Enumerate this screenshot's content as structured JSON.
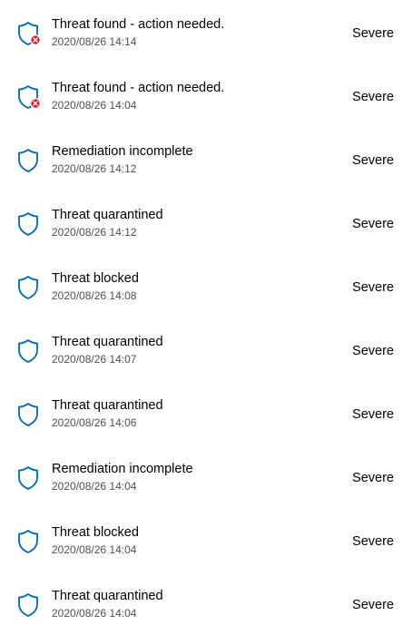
{
  "accent_color": "#0067c0",
  "badge_color": "#e81123",
  "icon": "shield-icon",
  "items": [
    {
      "title": "Threat found - action needed.",
      "timestamp": "2020/08/26 14:14",
      "severity": "Severe",
      "badge": "error-badge-icon"
    },
    {
      "title": "Threat found - action needed.",
      "timestamp": "2020/08/26 14:04",
      "severity": "Severe",
      "badge": "error-badge-icon"
    },
    {
      "title": "Remediation incomplete",
      "timestamp": "2020/08/26 14:12",
      "severity": "Severe",
      "badge": ""
    },
    {
      "title": "Threat quarantined",
      "timestamp": "2020/08/26 14:12",
      "severity": "Severe",
      "badge": ""
    },
    {
      "title": "Threat blocked",
      "timestamp": "2020/08/26 14:08",
      "severity": "Severe",
      "badge": ""
    },
    {
      "title": "Threat quarantined",
      "timestamp": "2020/08/26 14:07",
      "severity": "Severe",
      "badge": ""
    },
    {
      "title": "Threat quarantined",
      "timestamp": "2020/08/26 14:06",
      "severity": "Severe",
      "badge": ""
    },
    {
      "title": "Remediation incomplete",
      "timestamp": "2020/08/26 14:04",
      "severity": "Severe",
      "badge": ""
    },
    {
      "title": "Threat blocked",
      "timestamp": "2020/08/26 14:04",
      "severity": "Severe",
      "badge": ""
    },
    {
      "title": "Threat quarantined",
      "timestamp": "2020/08/26 14:04",
      "severity": "Severe",
      "badge": ""
    }
  ]
}
